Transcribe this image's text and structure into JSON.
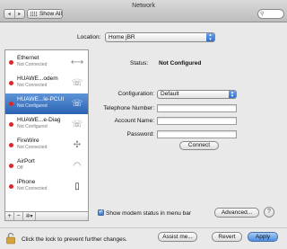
{
  "window": {
    "title": "Network"
  },
  "toolbar": {
    "back_label": "◂",
    "forward_label": "▸",
    "show_all_label": "Show All",
    "search_placeholder": ""
  },
  "location": {
    "label": "Location:",
    "value": "Home jBR"
  },
  "services": [
    {
      "name": "Ethernet",
      "status": "Not Connected",
      "status_color": "#d8282b",
      "icon": "ethernet-arrows-icon",
      "icon_glyph": "⟷",
      "selected": false
    },
    {
      "name": "HUAWE...odem",
      "status": "Not Connected",
      "status_color": "#d8282b",
      "icon": "phone-modem-icon",
      "icon_glyph": "☏",
      "selected": false
    },
    {
      "name": "HUAWE...le-PCUI",
      "status": "Not Configured",
      "status_color": "#d8282b",
      "icon": "phone-modem-icon",
      "icon_glyph": "☏",
      "selected": true
    },
    {
      "name": "HUAWE...e-Diag",
      "status": "Not Configured",
      "status_color": "#d8282b",
      "icon": "phone-modem-icon",
      "icon_glyph": "☏",
      "selected": false
    },
    {
      "name": "FireWire",
      "status": "Not Connected",
      "status_color": "#d8282b",
      "icon": "firewire-icon",
      "icon_glyph": "✣",
      "selected": false
    },
    {
      "name": "AirPort",
      "status": "Off",
      "status_color": "#d8282b",
      "icon": "wifi-icon",
      "icon_glyph": "◠",
      "selected": false
    },
    {
      "name": "iPhone",
      "status": "Not Connected",
      "status_color": "#d8282b",
      "icon": "iphone-icon",
      "icon_glyph": "▯",
      "selected": false
    }
  ],
  "sidebar_footer": {
    "add": "+",
    "remove": "−",
    "gear": "✲▾"
  },
  "detail": {
    "status_label": "Status:",
    "status_value": "Not Configured",
    "configuration_label": "Configuration:",
    "configuration_value": "Default",
    "telephone_label": "Telephone Number:",
    "telephone_value": "",
    "account_label": "Account Name:",
    "account_value": "",
    "password_label": "Password:",
    "password_value": "",
    "connect_label": "Connect"
  },
  "modem": {
    "checked": true,
    "check_glyph": "✓",
    "label": "Show modem status in menu bar"
  },
  "advanced_label": "Advanced...",
  "help_label": "?",
  "bottom": {
    "lock_text": "Click the lock to prevent further changes.",
    "assist_label": "Assist me...",
    "revert_label": "Revert",
    "apply_label": "Apply"
  },
  "colors": {
    "selection": "#3a70c2",
    "status_red": "#d8282b",
    "default_button": "#4c8de0"
  }
}
